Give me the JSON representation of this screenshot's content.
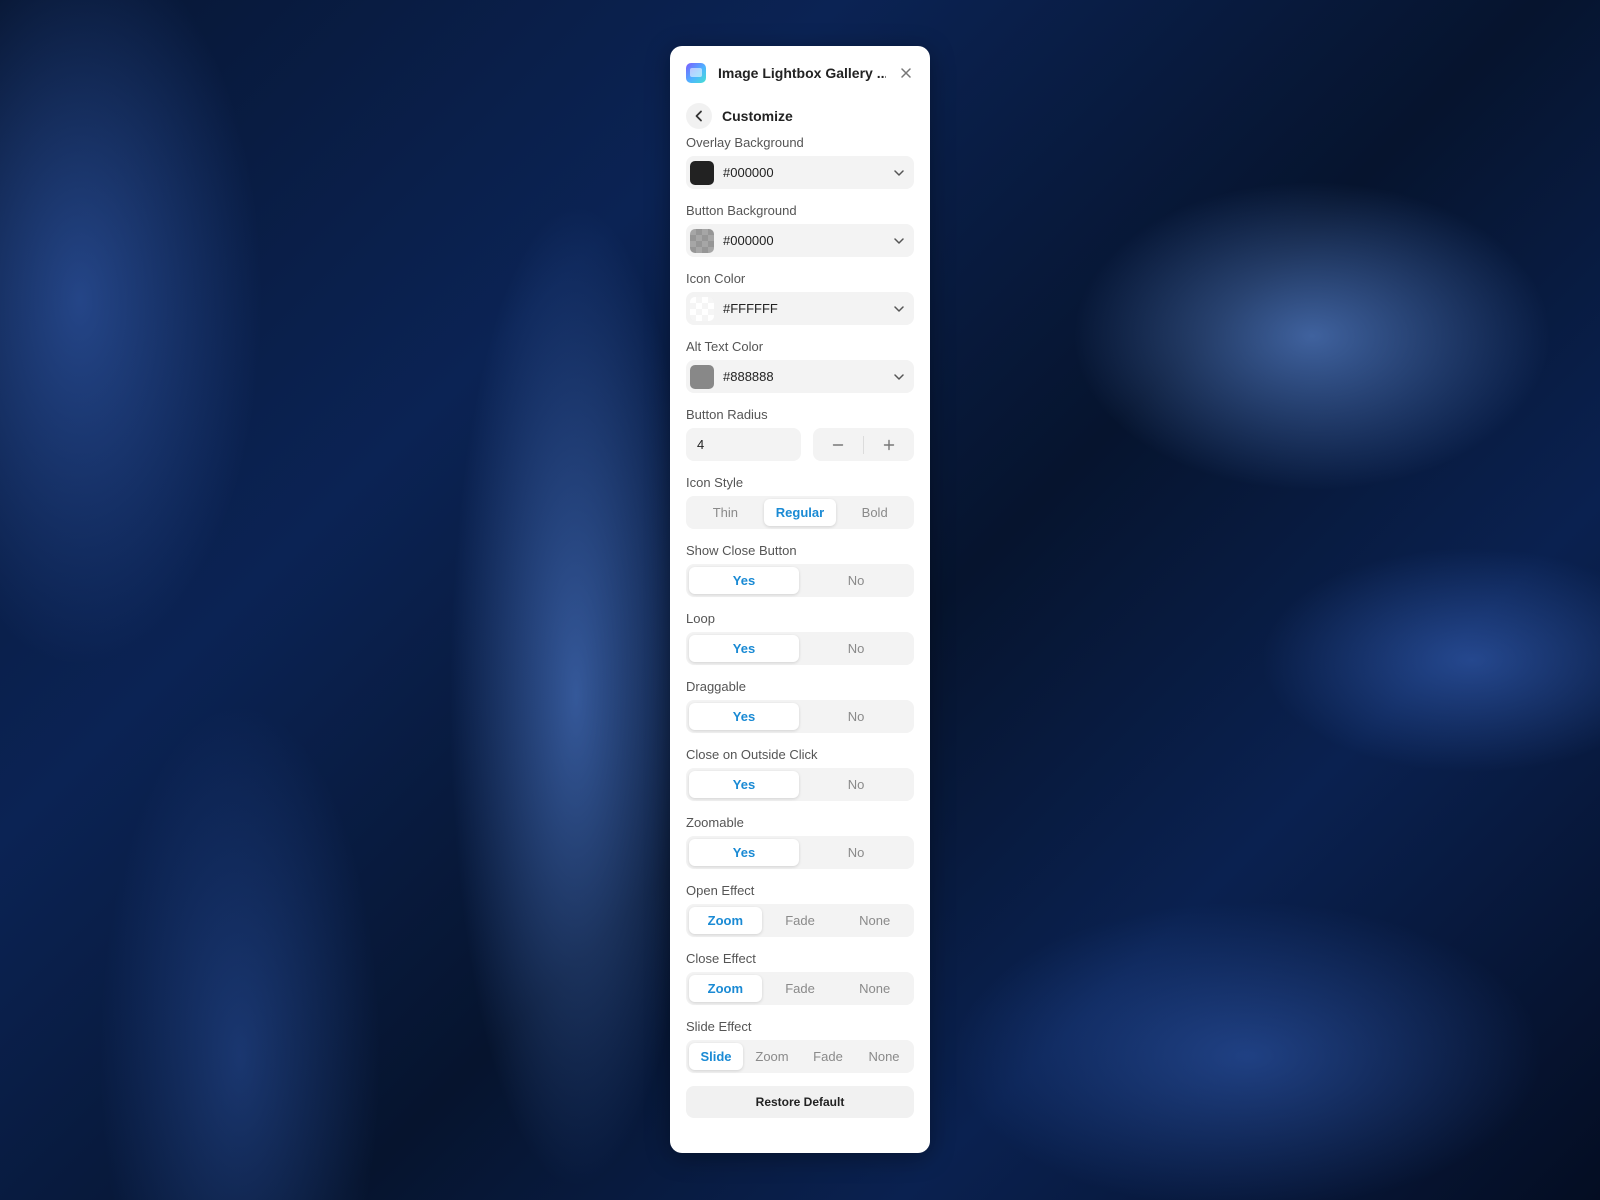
{
  "header": {
    "title": "Image Lightbox Gallery ...",
    "logo_icon": "app-logo-icon",
    "close_icon": "close-icon"
  },
  "subheader": {
    "title": "Customize",
    "back_icon": "chevron-left-icon"
  },
  "colors": {
    "accent": "#1a8ad4",
    "panel_bg": "#ffffff",
    "control_bg": "#f3f3f3"
  },
  "fields": {
    "overlay_background": {
      "label": "Overlay Background",
      "value": "#000000",
      "swatch": "#222222"
    },
    "button_background": {
      "label": "Button Background",
      "value": "#000000",
      "swatch": "rgba(0,0,0,0.35)"
    },
    "icon_color": {
      "label": "Icon Color",
      "value": "#FFFFFF",
      "swatch": "rgba(255,255,255,0.6)"
    },
    "alt_text_color": {
      "label": "Alt Text Color",
      "value": "#888888",
      "swatch": "#888888"
    },
    "button_radius": {
      "label": "Button Radius",
      "value": "4",
      "minus": "−",
      "plus": "+"
    },
    "icon_style": {
      "label": "Icon Style",
      "options": [
        "Thin",
        "Regular",
        "Bold"
      ],
      "selected": "Regular"
    },
    "show_close_button": {
      "label": "Show Close Button",
      "options": [
        "Yes",
        "No"
      ],
      "selected": "Yes"
    },
    "loop": {
      "label": "Loop",
      "options": [
        "Yes",
        "No"
      ],
      "selected": "Yes"
    },
    "draggable": {
      "label": "Draggable",
      "options": [
        "Yes",
        "No"
      ],
      "selected": "Yes"
    },
    "close_on_outside_click": {
      "label": "Close on Outside Click",
      "options": [
        "Yes",
        "No"
      ],
      "selected": "Yes"
    },
    "zoomable": {
      "label": "Zoomable",
      "options": [
        "Yes",
        "No"
      ],
      "selected": "Yes"
    },
    "open_effect": {
      "label": "Open Effect",
      "options": [
        "Zoom",
        "Fade",
        "None"
      ],
      "selected": "Zoom"
    },
    "close_effect": {
      "label": "Close Effect",
      "options": [
        "Zoom",
        "Fade",
        "None"
      ],
      "selected": "Zoom"
    },
    "slide_effect": {
      "label": "Slide Effect",
      "options": [
        "Slide",
        "Zoom",
        "Fade",
        "None"
      ],
      "selected": "Slide"
    }
  },
  "footer": {
    "restore_label": "Restore Default"
  }
}
